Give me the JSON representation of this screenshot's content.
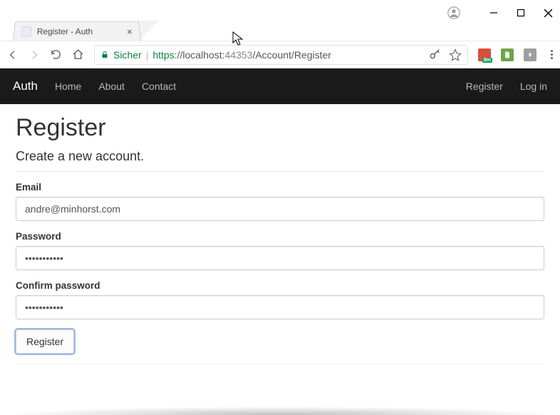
{
  "window": {
    "tab_title": "Register - Auth"
  },
  "omnibox": {
    "secure_label": "Sicher",
    "url_scheme": "https:",
    "url_host": "//localhost:",
    "url_port": "44353",
    "url_path": "/Account/Register"
  },
  "navbar": {
    "brand": "Auth",
    "links": [
      "Home",
      "About",
      "Contact"
    ],
    "right_links": [
      "Register",
      "Log in"
    ]
  },
  "page": {
    "heading": "Register",
    "subtitle": "Create a new account.",
    "email_label": "Email",
    "email_value": "andre@minhorst.com",
    "password_label": "Password",
    "password_value": "•••••••••••",
    "confirm_label": "Confirm password",
    "confirm_value": "•••••••••••",
    "submit_label": "Register"
  }
}
